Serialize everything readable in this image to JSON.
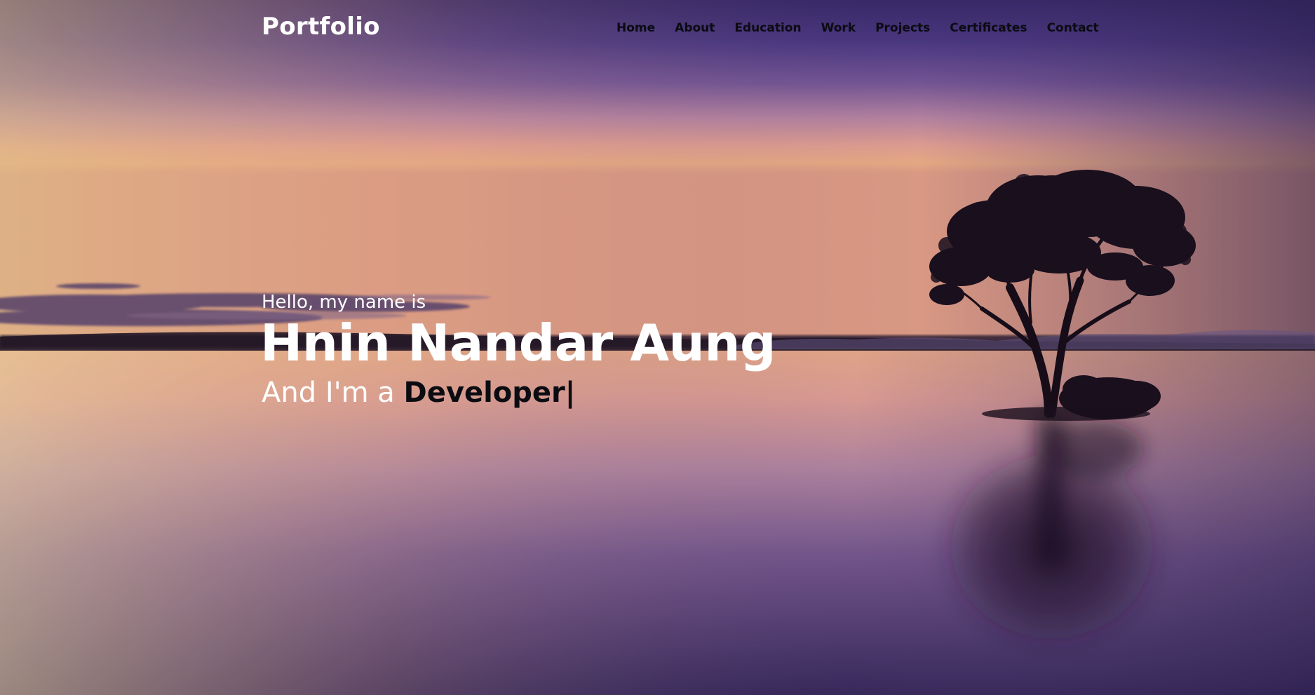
{
  "brand": {
    "logo": "Portfolio"
  },
  "nav": {
    "items": [
      {
        "label": "Home"
      },
      {
        "label": "About"
      },
      {
        "label": "Education"
      },
      {
        "label": "Work"
      },
      {
        "label": "Projects"
      },
      {
        "label": "Certificates"
      },
      {
        "label": "Contact"
      }
    ]
  },
  "hero": {
    "greeting": "Hello, my name is",
    "name": "Hnin Nandar Aung",
    "role_prefix": "And I'm a",
    "role_word": "Developer",
    "cursor": "|"
  },
  "colors": {
    "nav_text": "#0b0b12",
    "hero_text": "#ffffff",
    "sky_top": "#3f2e73",
    "horizon_glow": "#f7b27e",
    "water_bottom": "#3a2a5e"
  },
  "background": {
    "scene": "sunset over calm lake with silhouette tree and reflection"
  }
}
